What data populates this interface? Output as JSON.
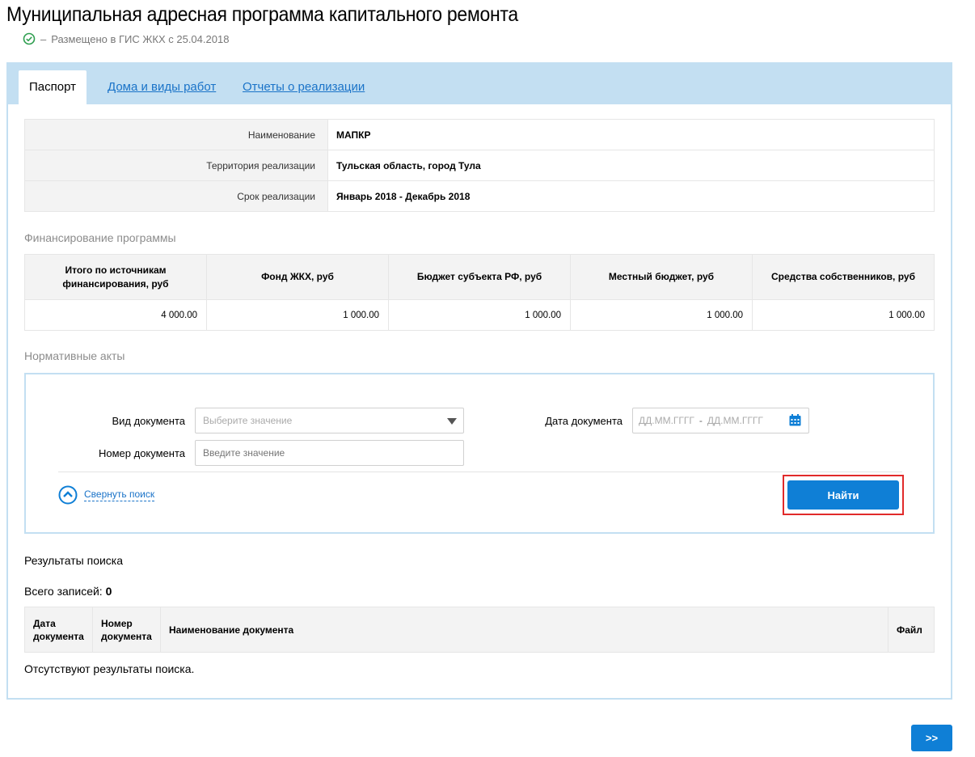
{
  "page": {
    "title": "Муниципальная адресная программа капитального ремонта",
    "status_dash": "–",
    "status_text": "Размещено в ГИС ЖКХ с 25.04.2018",
    "colors": {
      "accent": "#0f7fd6",
      "tabbar": "#c3dff2",
      "highlight": "#e12a2a",
      "status_ok": "#2e9e4f"
    }
  },
  "tabs": [
    {
      "label": "Паспорт"
    },
    {
      "label": "Дома и виды работ"
    },
    {
      "label": "Отчеты о реализации"
    }
  ],
  "passport": {
    "rows": [
      {
        "label": "Наименование",
        "value": "МАПКР"
      },
      {
        "label": "Территория реализации",
        "value": "Тульская область, город Тула"
      },
      {
        "label": "Срок реализации",
        "value": "Январь 2018 - Декабрь 2018"
      }
    ]
  },
  "financing": {
    "title": "Финансирование программы",
    "headers": [
      "Итого по источникам финансирования, руб",
      "Фонд ЖКХ, руб",
      "Бюджет субъекта РФ, руб",
      "Местный бюджет, руб",
      "Средства собственников, руб"
    ],
    "values": [
      "4 000.00",
      "1 000.00",
      "1 000.00",
      "1 000.00",
      "1 000.00"
    ]
  },
  "acts": {
    "title": "Нормативные акты",
    "doc_type_label": "Вид документа",
    "doc_type_placeholder": "Выберите значение",
    "doc_number_label": "Номер документа",
    "doc_number_placeholder": "Введите значение",
    "doc_date_label": "Дата документа",
    "date_from_placeholder": "ДД.ММ.ГГГГ",
    "date_sep": "-",
    "date_to_placeholder": "ДД.ММ.ГГГГ",
    "collapse_label": "Свернуть поиск",
    "find_label": "Найти"
  },
  "results": {
    "title": "Результаты поиска",
    "total_label": "Всего записей:",
    "total_count": "0",
    "columns": [
      "Дата документа",
      "Номер документа",
      "Наименование документа",
      "Файл"
    ],
    "empty_text": "Отсутствуют результаты поиска."
  },
  "pager": {
    "next_label": ">>"
  }
}
